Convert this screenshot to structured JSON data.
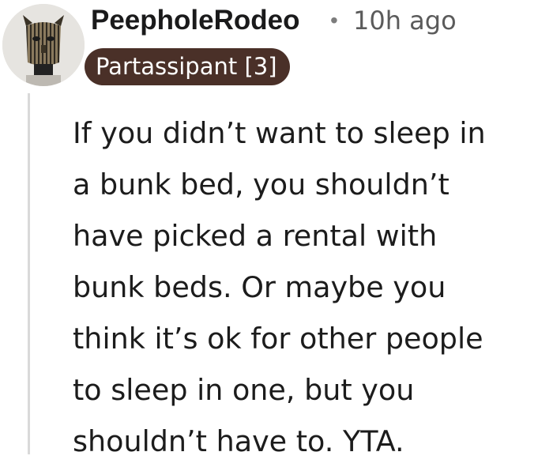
{
  "comment": {
    "username": "PeepholeRodeo",
    "separator": "•",
    "timestamp": "10h ago",
    "flair": "Partassipant [3]",
    "body_lines": [
      "If you didn’t want to sleep in",
      "a bunk bed, you shouldn’t",
      "have picked a rental with",
      "bunk beds. Or maybe you",
      "think it’s ok for other people",
      "to sleep in one, but you",
      "shouldn’t have to. YTA."
    ]
  },
  "icons": {
    "avatar": "user-avatar-icon"
  },
  "colors": {
    "flair_background": "#4a3028",
    "flair_text": "#ffffff",
    "username": "#1a1a1b",
    "meta": "#5b5b5b",
    "thread_line": "#d9d9d9"
  }
}
